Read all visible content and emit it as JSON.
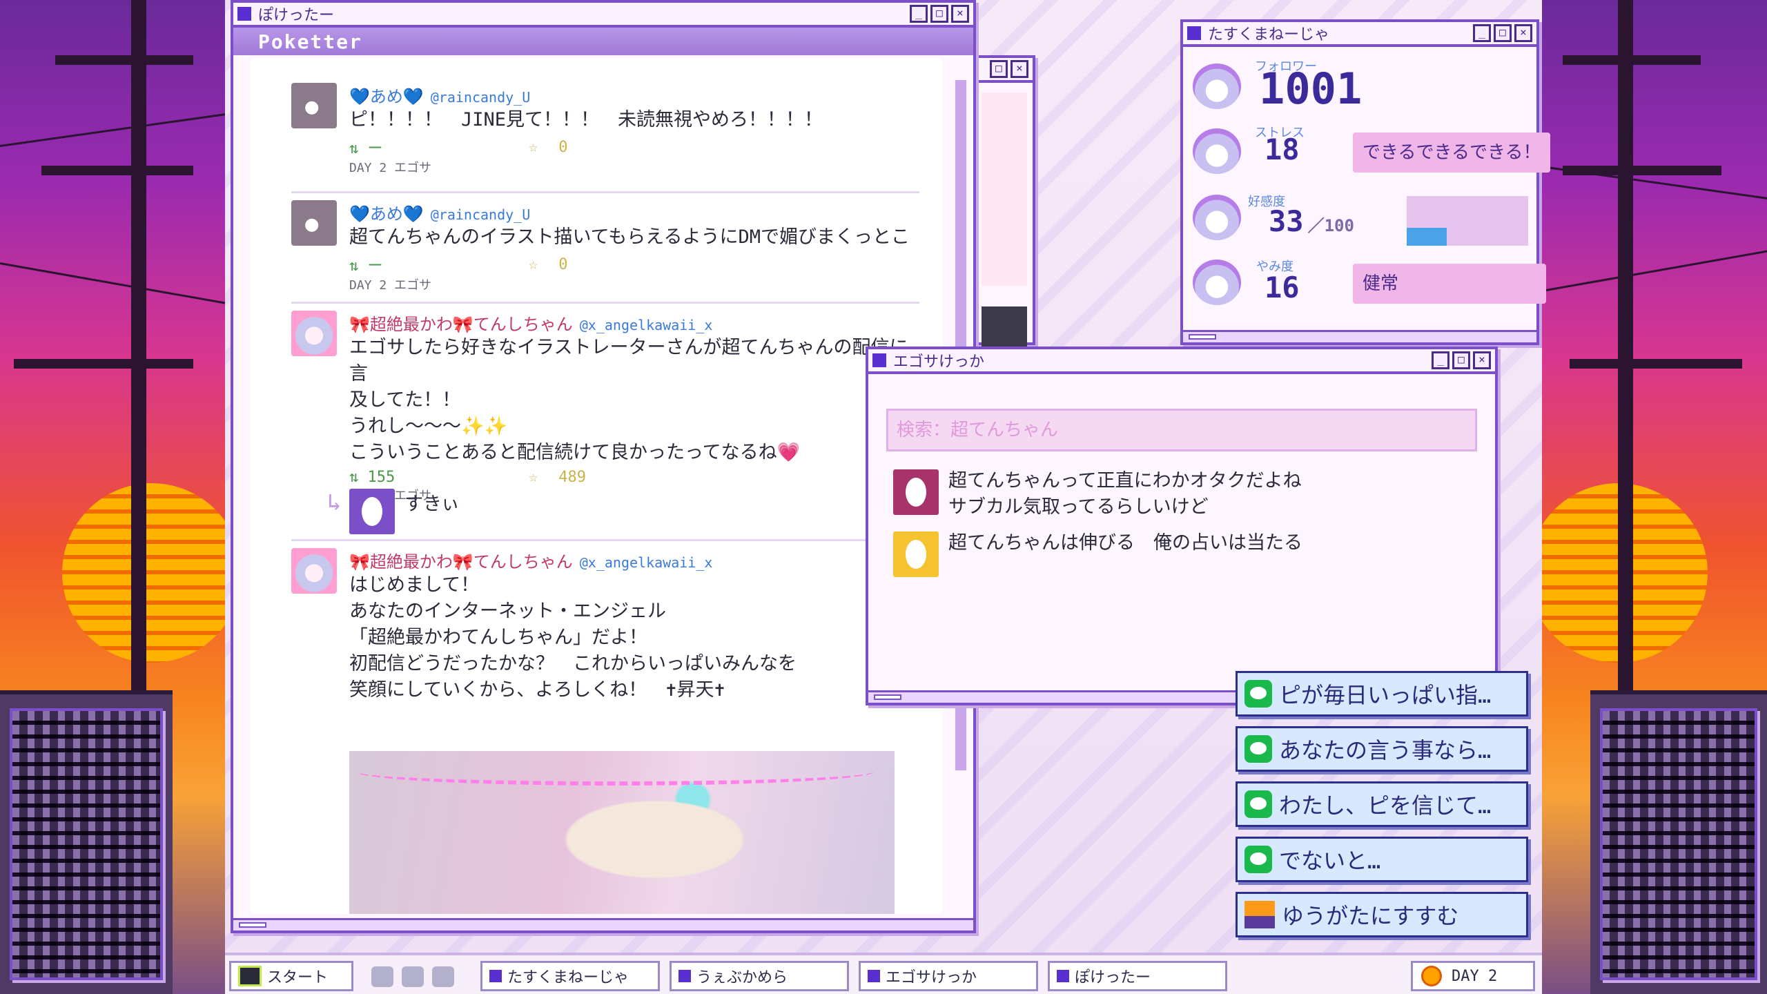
{
  "poketter": {
    "window_title": "ぽけったー",
    "brand": "Poketter",
    "posts": [
      {
        "user": "💙あめ💙",
        "handle": "@raincandy_U",
        "text": "ピ！！！！　JINE見て！！！　未読無視やめろ！！！！",
        "retweets": "ー",
        "likes": "0",
        "day": "DAY 2 エゴサ"
      },
      {
        "user": "💙あめ💙",
        "handle": "@raincandy_U",
        "text": "超てんちゃんのイラスト描いてもらえるようにDMで媚びまくっとこ",
        "retweets": "ー",
        "likes": "0",
        "day": "DAY 2 エゴサ"
      },
      {
        "user": "🎀超絶最かわ🎀てんしちゃん",
        "handle": "@x_angelkawaii_x",
        "text": "エゴサしたら好きなイラストレーターさんが超てんちゃんの配信に言\n及してた！！\nうれし～～～✨✨\nこういうことあると配信続けて良かったってなるね💗",
        "retweets": "155",
        "likes": "489",
        "day": "DAY 2 エゴサ",
        "reply": "すきぃ"
      },
      {
        "user": "🎀超絶最かわ🎀てんしちゃん",
        "handle": "@x_angelkawaii_x",
        "text": "はじめまして！\nあなたのインターネット・エンジェル\n「超絶最かわてんしちゃん」だよ！\n初配信どうだったかな？　これからいっぱいみんなを\n笑顔にしていくから、よろしくね！　✝昇天✝"
      }
    ]
  },
  "taskmanager": {
    "window_title": "たすくまねーじゃ",
    "followers_label": "フォロワー",
    "followers": "1001",
    "stress_label": "ストレス",
    "stress": "18",
    "stress_bubble": "できるできるできる！",
    "affection_label": "好感度",
    "affection": "33",
    "affection_max": "100",
    "affection_fill": 0.33,
    "yami_label": "やみ度",
    "yami": "16",
    "yami_bubble": "健常"
  },
  "egosa": {
    "window_title": "エゴサけっか",
    "search": "検索：超てんちゃん",
    "results": [
      {
        "text": "超てんちゃんって正直にわかオタクだよね\nサブカル気取ってるらしいけど",
        "color": "#a8336a"
      },
      {
        "text": "超てんちゃんは伸びる　俺の占いは当たる",
        "color": "#f5c230"
      }
    ]
  },
  "actions": [
    {
      "label": "ピが毎日いっぱい指…",
      "icon": "jine-icon"
    },
    {
      "label": "あなたの言う事なら…",
      "icon": "jine-icon"
    },
    {
      "label": "わたし、ピを信じて…",
      "icon": "jine-icon"
    },
    {
      "label": "でないと…",
      "icon": "jine-icon"
    },
    {
      "label": "ゆうがたにすすむ",
      "icon": "sunset-icon"
    }
  ],
  "taskbar": {
    "start": "スタート",
    "items": [
      "たすくまねーじゃ",
      "うぇぶかめら",
      "エゴサけっか",
      "ぽけったー"
    ],
    "day": "DAY 2"
  }
}
